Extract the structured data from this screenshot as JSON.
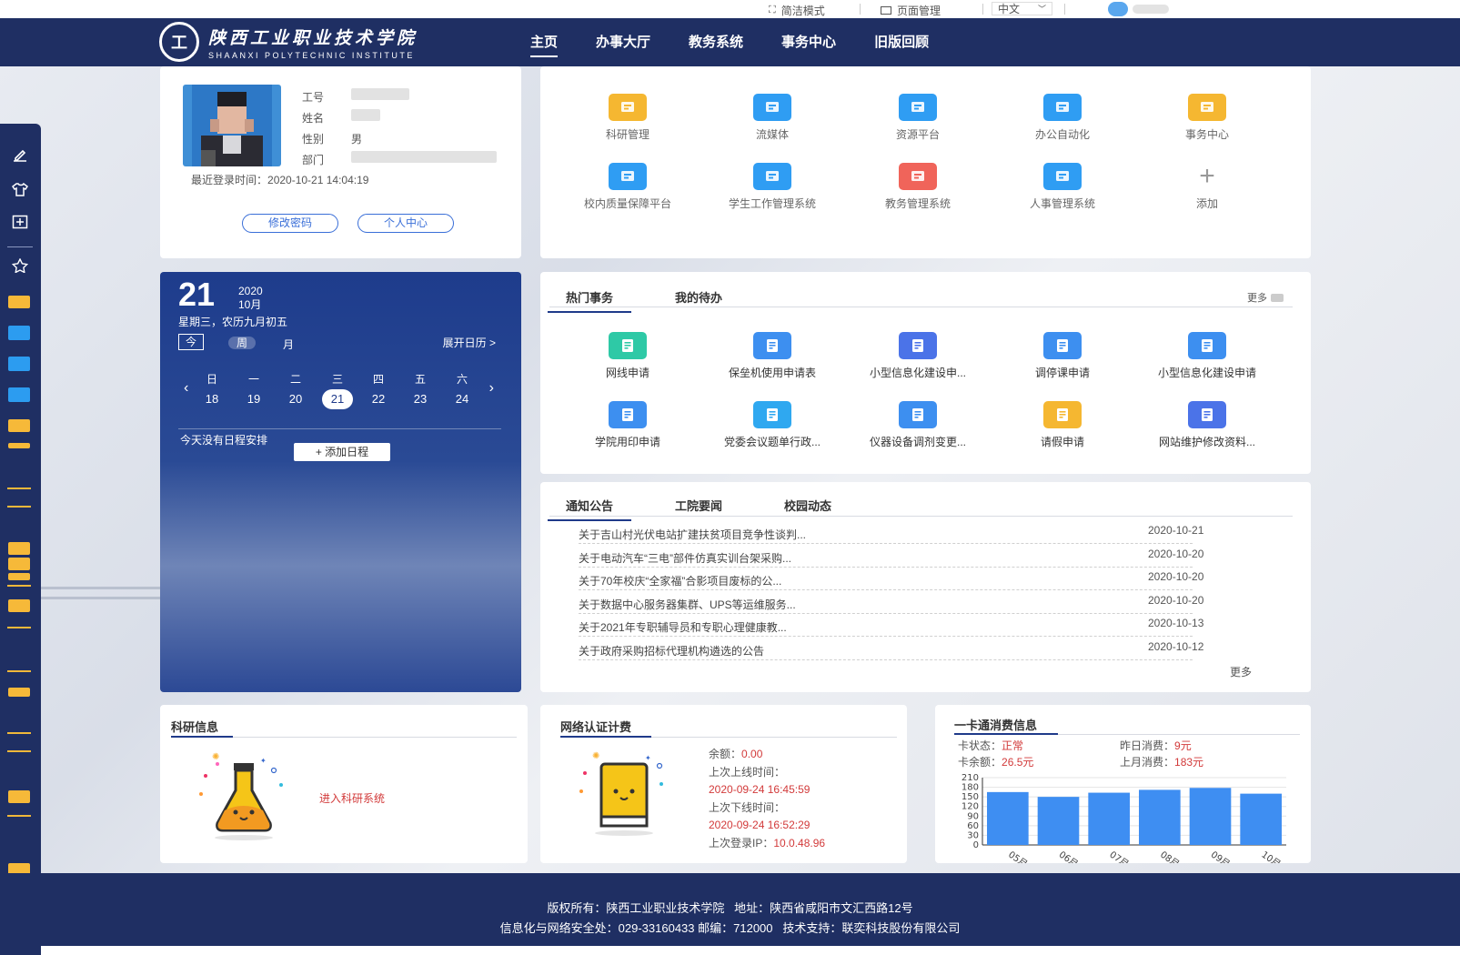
{
  "topbar": {
    "simple_mode": "简洁模式",
    "page_manage": "页面管理",
    "language": "中文"
  },
  "header": {
    "logo_cn": "陕西工业职业技术学院",
    "logo_en": "SHAANXI POLYTECHNIC INSTITUTE",
    "nav": [
      {
        "label": "主页"
      },
      {
        "label": "办事大厅"
      },
      {
        "label": "教务系统"
      },
      {
        "label": "事务中心"
      },
      {
        "label": "旧版回顾"
      }
    ]
  },
  "profile": {
    "labels": [
      "工号",
      "姓名",
      "性别",
      "部门"
    ],
    "gender": "男",
    "last_login_label": "最近登录时间：",
    "last_login": "2020-10-21 14:04:19",
    "change_password": "修改密码",
    "personal_center": "个人中心"
  },
  "apps": [
    {
      "label": "科研管理",
      "icon": "folder-icon",
      "color": "#f5b731"
    },
    {
      "label": "流媒体",
      "icon": "media-icon",
      "color": "#2f9df3"
    },
    {
      "label": "资源平台",
      "icon": "resource-icon",
      "color": "#2f9df3"
    },
    {
      "label": "办公自动化",
      "icon": "office-icon",
      "color": "#2f9df3"
    },
    {
      "label": "事务中心",
      "icon": "affairs-icon",
      "color": "#f5b731"
    },
    {
      "label": "校内质量保障平台",
      "icon": "bell-icon",
      "color": "#2f9df3"
    },
    {
      "label": "学生工作管理系统",
      "icon": "graduate-icon",
      "color": "#2f9df3"
    },
    {
      "label": "教务管理系统",
      "icon": "user-icon",
      "color": "#f0645a"
    },
    {
      "label": "人事管理系统",
      "icon": "document-icon",
      "color": "#2f9df3"
    },
    {
      "label": "添加",
      "icon": "plus-icon",
      "color": "#ffffff"
    }
  ],
  "calendar": {
    "day": "21",
    "year": "2020",
    "month": "10月",
    "weekday_lunar": "星期三，农历九月初五",
    "today": "今",
    "week": "周",
    "month_view": "月",
    "expand": "展开日历 >",
    "week_headers": [
      "日",
      "一",
      "二",
      "三",
      "四",
      "五",
      "六"
    ],
    "dates": [
      "18",
      "19",
      "20",
      "21",
      "22",
      "23",
      "24"
    ],
    "selected_index": 3,
    "no_events": "今天没有日程安排",
    "add_event": "+ 添加日程"
  },
  "affairs": {
    "tabs": [
      "热门事务",
      "我的待办"
    ],
    "more": "更多",
    "items": [
      {
        "label": "网线申请",
        "color": "#2ec9a6"
      },
      {
        "label": "保垒机使用申请表",
        "color": "#3d8ff0"
      },
      {
        "label": "小型信息化建设申...",
        "color": "#4b73e8"
      },
      {
        "label": "调停课申请",
        "color": "#3d8ff0"
      },
      {
        "label": "小型信息化建设申请",
        "color": "#3d8ff0"
      },
      {
        "label": "学院用印申请",
        "color": "#3d8ff0"
      },
      {
        "label": "党委会议题单行政...",
        "color": "#2fa8f0"
      },
      {
        "label": "仪器设备调剂变更...",
        "color": "#3d8ff0"
      },
      {
        "label": "请假申请",
        "color": "#f5b731"
      },
      {
        "label": "网站维护修改资料...",
        "color": "#4b73e8"
      }
    ]
  },
  "news": {
    "tabs": [
      "通知公告",
      "工院要闻",
      "校园动态"
    ],
    "more": "更多",
    "items": [
      {
        "title": "关于吉山村光伏电站扩建扶贫项目竞争性谈判...",
        "date": "2020-10-21"
      },
      {
        "title": "关于电动汽车“三电”部件仿真实训台架采购...",
        "date": "2020-10-20"
      },
      {
        "title": "关于70年校庆“全家福”合影项目废标的公...",
        "date": "2020-10-20"
      },
      {
        "title": "关于数据中心服务器集群、UPS等运维服务...",
        "date": "2020-10-20"
      },
      {
        "title": "关于2021年专职辅导员和专职心理健康教...",
        "date": "2020-10-13"
      },
      {
        "title": "关于政府采购招标代理机构遴选的公告",
        "date": "2020-10-12"
      }
    ]
  },
  "research": {
    "title": "科研信息",
    "link": "进入科研系统"
  },
  "network": {
    "title": "网络认证计费",
    "balance_label": "余额：",
    "balance": "0.00",
    "last_online_label": "上次上线时间：",
    "last_online": "2020-09-24 16:45:59",
    "last_offline_label": "上次下线时间：",
    "last_offline": "2020-09-24 16:52:29",
    "last_ip_label": "上次登录IP：",
    "last_ip": "10.0.48.96"
  },
  "card": {
    "title": "一卡通消费信息",
    "status_label": "卡状态：",
    "status": "正常",
    "yesterday_label": "昨日消费：",
    "yesterday": "9元",
    "balance_label": "卡余额：",
    "balance": "26.5元",
    "last_month_label": "上月消费：",
    "last_month": "183元"
  },
  "chart_data": {
    "type": "bar",
    "categories": [
      "05月",
      "06月",
      "07月",
      "08月",
      "09月",
      "10月"
    ],
    "values": [
      165,
      150,
      163,
      172,
      178,
      160
    ],
    "ylim": [
      0,
      210
    ],
    "yticks": [
      0,
      30,
      60,
      90,
      120,
      150,
      180,
      210
    ],
    "color": "#3e8ef2"
  },
  "footer": {
    "line1": "版权所有：陕西工业职业技术学院   地址：陕西省咸阳市文汇西路12号",
    "line2": "信息化与网络安全处：029-33160433 邮编：712000   技术支持：联奕科技股份有限公司"
  }
}
